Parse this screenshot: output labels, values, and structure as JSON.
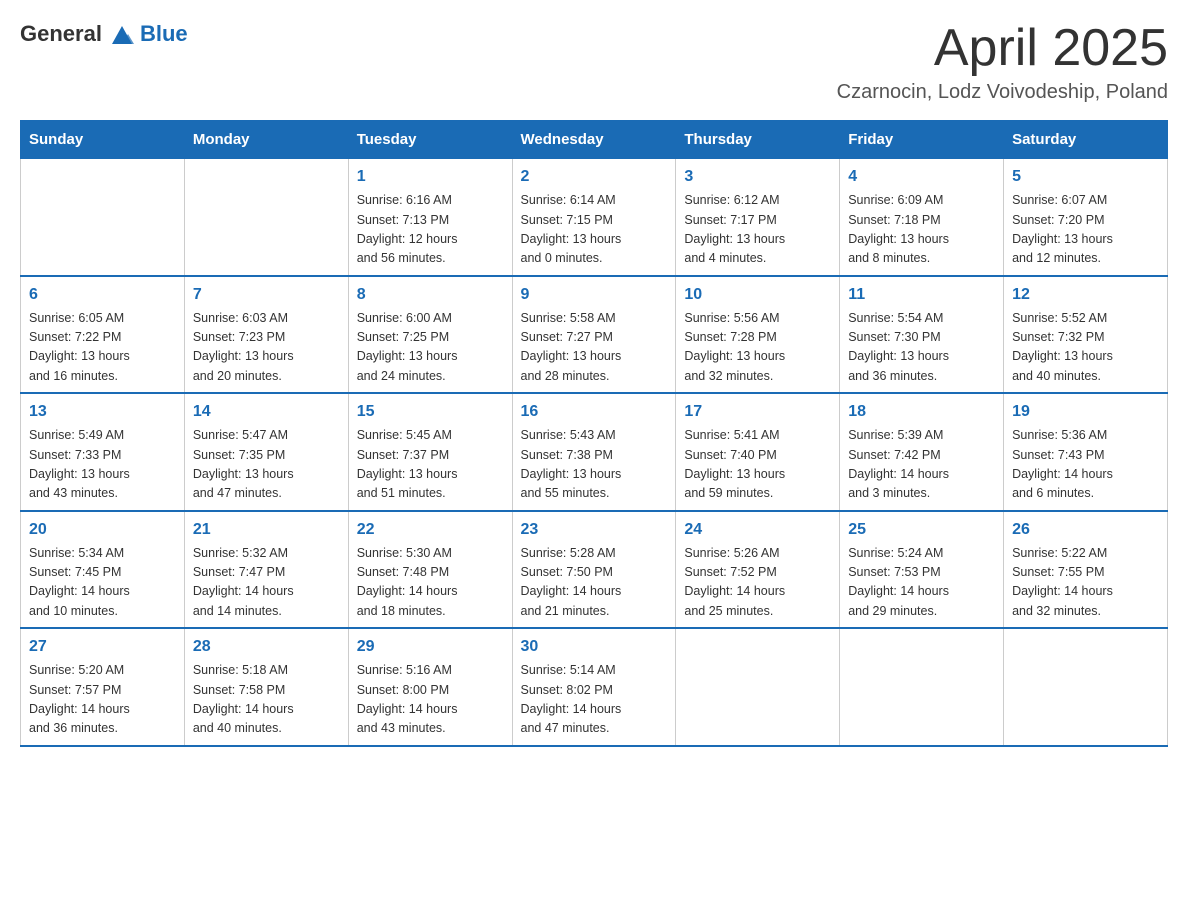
{
  "header": {
    "logo": {
      "text_general": "General",
      "text_blue": "Blue"
    },
    "title": "April 2025",
    "subtitle": "Czarnocin, Lodz Voivodeship, Poland"
  },
  "columns": [
    "Sunday",
    "Monday",
    "Tuesday",
    "Wednesday",
    "Thursday",
    "Friday",
    "Saturday"
  ],
  "weeks": [
    [
      {
        "day": "",
        "info": ""
      },
      {
        "day": "",
        "info": ""
      },
      {
        "day": "1",
        "info": "Sunrise: 6:16 AM\nSunset: 7:13 PM\nDaylight: 12 hours\nand 56 minutes."
      },
      {
        "day": "2",
        "info": "Sunrise: 6:14 AM\nSunset: 7:15 PM\nDaylight: 13 hours\nand 0 minutes."
      },
      {
        "day": "3",
        "info": "Sunrise: 6:12 AM\nSunset: 7:17 PM\nDaylight: 13 hours\nand 4 minutes."
      },
      {
        "day": "4",
        "info": "Sunrise: 6:09 AM\nSunset: 7:18 PM\nDaylight: 13 hours\nand 8 minutes."
      },
      {
        "day": "5",
        "info": "Sunrise: 6:07 AM\nSunset: 7:20 PM\nDaylight: 13 hours\nand 12 minutes."
      }
    ],
    [
      {
        "day": "6",
        "info": "Sunrise: 6:05 AM\nSunset: 7:22 PM\nDaylight: 13 hours\nand 16 minutes."
      },
      {
        "day": "7",
        "info": "Sunrise: 6:03 AM\nSunset: 7:23 PM\nDaylight: 13 hours\nand 20 minutes."
      },
      {
        "day": "8",
        "info": "Sunrise: 6:00 AM\nSunset: 7:25 PM\nDaylight: 13 hours\nand 24 minutes."
      },
      {
        "day": "9",
        "info": "Sunrise: 5:58 AM\nSunset: 7:27 PM\nDaylight: 13 hours\nand 28 minutes."
      },
      {
        "day": "10",
        "info": "Sunrise: 5:56 AM\nSunset: 7:28 PM\nDaylight: 13 hours\nand 32 minutes."
      },
      {
        "day": "11",
        "info": "Sunrise: 5:54 AM\nSunset: 7:30 PM\nDaylight: 13 hours\nand 36 minutes."
      },
      {
        "day": "12",
        "info": "Sunrise: 5:52 AM\nSunset: 7:32 PM\nDaylight: 13 hours\nand 40 minutes."
      }
    ],
    [
      {
        "day": "13",
        "info": "Sunrise: 5:49 AM\nSunset: 7:33 PM\nDaylight: 13 hours\nand 43 minutes."
      },
      {
        "day": "14",
        "info": "Sunrise: 5:47 AM\nSunset: 7:35 PM\nDaylight: 13 hours\nand 47 minutes."
      },
      {
        "day": "15",
        "info": "Sunrise: 5:45 AM\nSunset: 7:37 PM\nDaylight: 13 hours\nand 51 minutes."
      },
      {
        "day": "16",
        "info": "Sunrise: 5:43 AM\nSunset: 7:38 PM\nDaylight: 13 hours\nand 55 minutes."
      },
      {
        "day": "17",
        "info": "Sunrise: 5:41 AM\nSunset: 7:40 PM\nDaylight: 13 hours\nand 59 minutes."
      },
      {
        "day": "18",
        "info": "Sunrise: 5:39 AM\nSunset: 7:42 PM\nDaylight: 14 hours\nand 3 minutes."
      },
      {
        "day": "19",
        "info": "Sunrise: 5:36 AM\nSunset: 7:43 PM\nDaylight: 14 hours\nand 6 minutes."
      }
    ],
    [
      {
        "day": "20",
        "info": "Sunrise: 5:34 AM\nSunset: 7:45 PM\nDaylight: 14 hours\nand 10 minutes."
      },
      {
        "day": "21",
        "info": "Sunrise: 5:32 AM\nSunset: 7:47 PM\nDaylight: 14 hours\nand 14 minutes."
      },
      {
        "day": "22",
        "info": "Sunrise: 5:30 AM\nSunset: 7:48 PM\nDaylight: 14 hours\nand 18 minutes."
      },
      {
        "day": "23",
        "info": "Sunrise: 5:28 AM\nSunset: 7:50 PM\nDaylight: 14 hours\nand 21 minutes."
      },
      {
        "day": "24",
        "info": "Sunrise: 5:26 AM\nSunset: 7:52 PM\nDaylight: 14 hours\nand 25 minutes."
      },
      {
        "day": "25",
        "info": "Sunrise: 5:24 AM\nSunset: 7:53 PM\nDaylight: 14 hours\nand 29 minutes."
      },
      {
        "day": "26",
        "info": "Sunrise: 5:22 AM\nSunset: 7:55 PM\nDaylight: 14 hours\nand 32 minutes."
      }
    ],
    [
      {
        "day": "27",
        "info": "Sunrise: 5:20 AM\nSunset: 7:57 PM\nDaylight: 14 hours\nand 36 minutes."
      },
      {
        "day": "28",
        "info": "Sunrise: 5:18 AM\nSunset: 7:58 PM\nDaylight: 14 hours\nand 40 minutes."
      },
      {
        "day": "29",
        "info": "Sunrise: 5:16 AM\nSunset: 8:00 PM\nDaylight: 14 hours\nand 43 minutes."
      },
      {
        "day": "30",
        "info": "Sunrise: 5:14 AM\nSunset: 8:02 PM\nDaylight: 14 hours\nand 47 minutes."
      },
      {
        "day": "",
        "info": ""
      },
      {
        "day": "",
        "info": ""
      },
      {
        "day": "",
        "info": ""
      }
    ]
  ]
}
